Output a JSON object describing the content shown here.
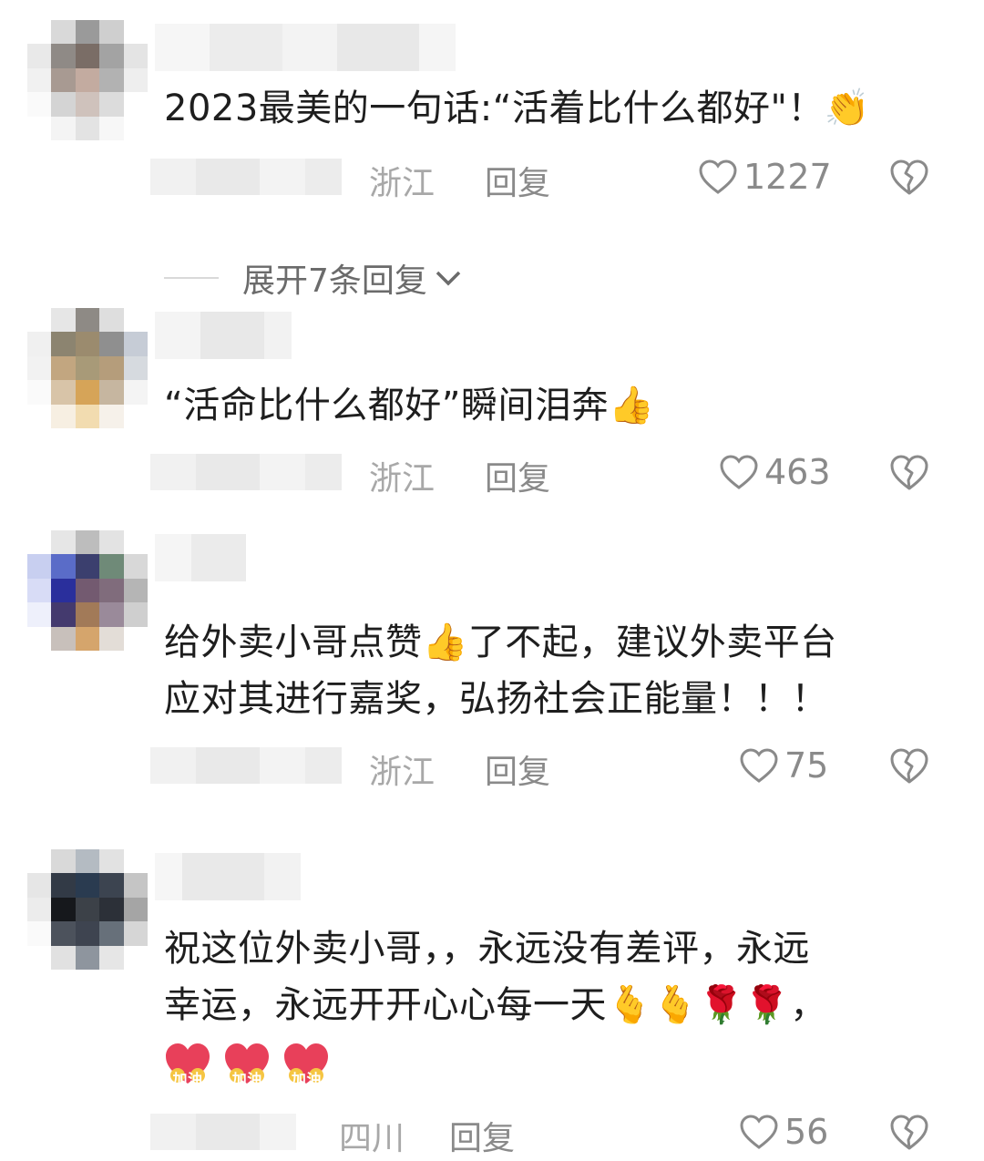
{
  "comments": [
    {
      "text": "2023最美的一句话:“活着比什么都好\"！",
      "emoji": "👏",
      "region": "浙江",
      "reply": "回复",
      "likes": "1227",
      "expand": "展开7条回复"
    },
    {
      "text": "“活命比什么都好”瞬间泪奔",
      "emoji": "👍",
      "region": "浙江",
      "reply": "回复",
      "likes": "463"
    },
    {
      "text_a": "给外卖小哥点赞",
      "emoji": "👍",
      "text_b": "了不起，建议外卖平台",
      "text_line2": "应对其进行嘉奖，弘扬社会正能量！！！",
      "region": "浙江",
      "reply": "回复",
      "likes": "75"
    },
    {
      "text_line1": "祝这位外卖小哥，，永远没有差评，永远",
      "text_line2": "幸运，永远开开心心每一天",
      "emojis_line2": "🫰🫰🌹🌹",
      "comma": "，",
      "sticker_label": "加油",
      "region": "四川",
      "reply": "回复",
      "likes": "56"
    }
  ],
  "colors": {
    "text": "#1e1e1e",
    "meta": "#8a8a8a",
    "region": "#a8a8a8"
  }
}
